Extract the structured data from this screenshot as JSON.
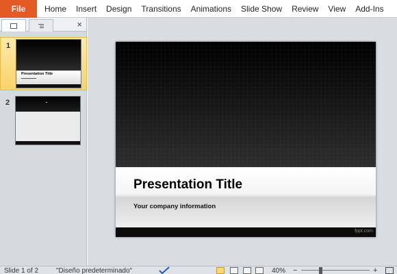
{
  "ribbon": {
    "file_label": "File",
    "tabs": [
      "Home",
      "Insert",
      "Design",
      "Transitions",
      "Animations",
      "Slide Show",
      "Review",
      "View",
      "Add-Ins"
    ]
  },
  "thumbnails": {
    "close_glyph": "×",
    "slides": [
      {
        "number": "1",
        "title": "Presentation Title",
        "selected": true
      },
      {
        "number": "2",
        "selected": false
      }
    ]
  },
  "slide": {
    "title": "Presentation Title",
    "subtitle": "Your company information",
    "credit": "fppt.com"
  },
  "status": {
    "slide_info": "Slide 1 of 2",
    "theme": "\"Diseño predeterminado\"",
    "zoom": "40%",
    "zoom_level": 0.4
  },
  "colors": {
    "file_tab": "#e35a24",
    "selected_thumb": "#f9d36a"
  },
  "icons": [
    "slides-tab-icon",
    "outline-tab-icon",
    "close-icon",
    "spell-check-icon",
    "normal-view-icon",
    "slide-sorter-icon",
    "reading-view-icon",
    "slide-show-icon",
    "zoom-out-icon",
    "zoom-in-icon",
    "fit-window-icon"
  ]
}
